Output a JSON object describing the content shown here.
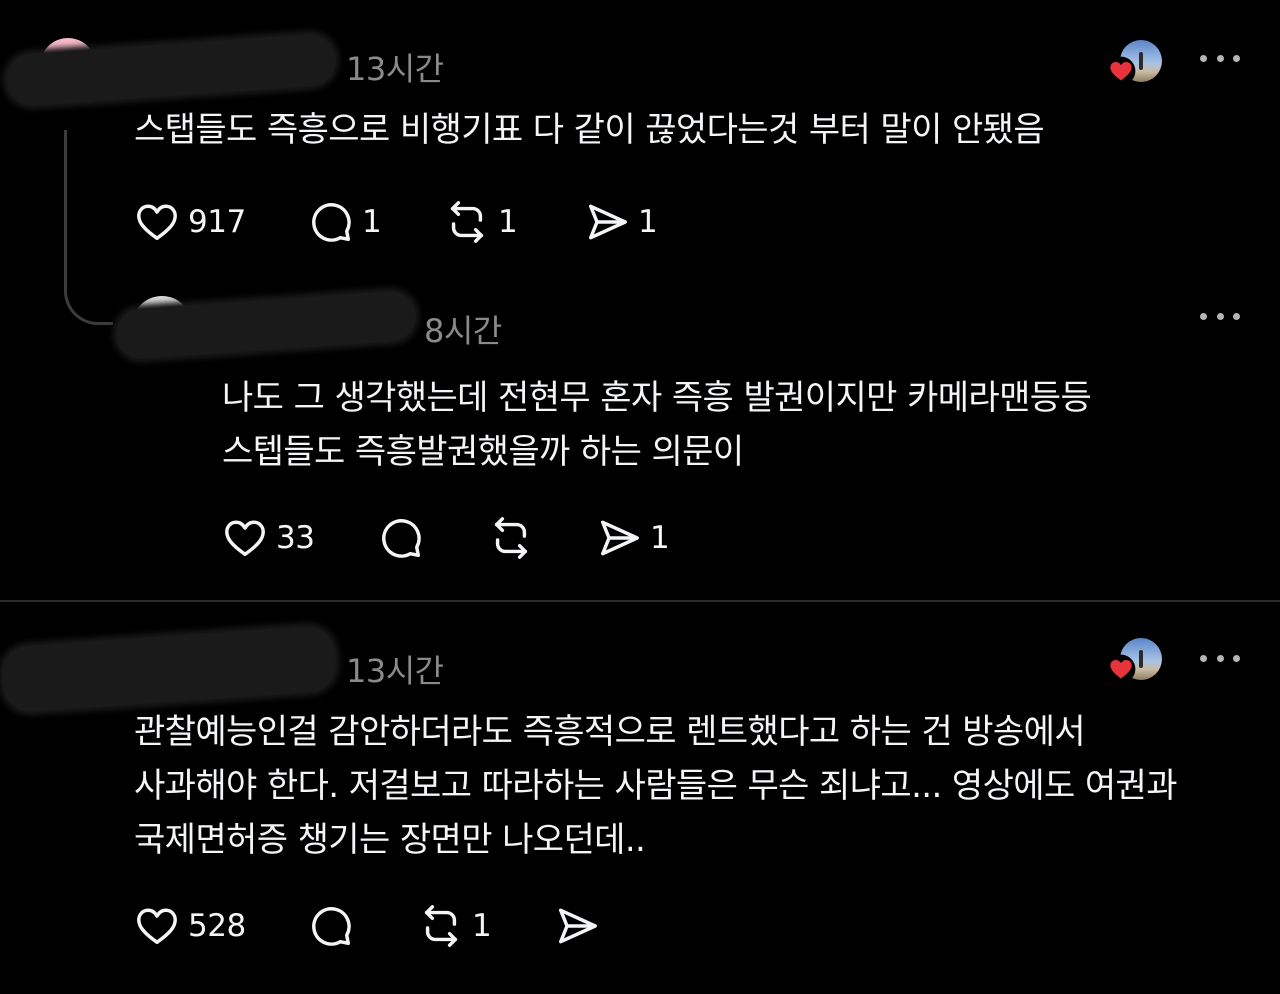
{
  "posts": [
    {
      "time": "13시간",
      "text": "스탭들도 즉흥으로 비행기표 다 같이 끊었다는것 부터 말이 안됐음",
      "likes": "917",
      "replies": "1",
      "reposts": "1",
      "shares": "1"
    },
    {
      "time": "8시간",
      "text_lines": [
        "나도 그 생각했는데 전현무 혼자 즉흥 발권이지만 카메라맨등등",
        "스텝들도 즉흥발권했을까 하는 의문이"
      ],
      "likes": "33",
      "replies": "",
      "reposts": "",
      "shares": "1"
    },
    {
      "time": "13시간",
      "text_lines": [
        "관찰예능인걸 감안하더라도 즉흥적으로 렌트했다고 하는 건 방송에서",
        "사과해야 한다. 저걸보고 따라하는 사람들은 무슨 죄냐고... 영상에도 여권과",
        "국제면허증 챙기는 장면만 나오던데.."
      ],
      "likes": "528",
      "replies": "",
      "reposts": "1",
      "shares": ""
    }
  ],
  "icons": {
    "like": "heart-icon",
    "reply": "comment-icon",
    "repost": "repost-icon",
    "share": "send-icon",
    "more": "more-icon",
    "liked_by_author": "heart-badge-icon"
  },
  "colors": {
    "background": "#000000",
    "text": "#f3f5f7",
    "muted": "#8a8a8a",
    "heart_badge": "#e8323c"
  }
}
